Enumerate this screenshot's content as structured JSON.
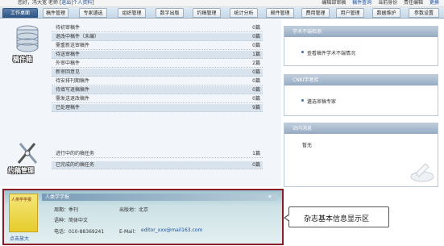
{
  "topbar": {
    "greeting": "您好，冯大宽 老师",
    "links": [
      "退出",
      "个人资料"
    ],
    "right": [
      "编辑部审稿",
      "稿件查询",
      "当前身份",
      "责任编辑",
      "更换"
    ]
  },
  "nav": {
    "tabs": [
      "工作桌面",
      "稿件管理",
      "专家遴选",
      "组织管理",
      "数字出版",
      "约稿管理",
      "统计分析",
      "邮件管理",
      "费用管理",
      "用户管理",
      "数据维护",
      "参数设置"
    ]
  },
  "manuscripts": {
    "title": "稿件箱",
    "rows": [
      {
        "label": "待初审稿件",
        "count": "0篇"
      },
      {
        "label": "退改中稿件（未编）",
        "count": "0篇"
      },
      {
        "label": "需重新送审稿件",
        "count": "0篇"
      },
      {
        "label": "待送审稿件",
        "count": "1篇"
      },
      {
        "label": "外审中稿件",
        "count": "2篇"
      },
      {
        "label": "新审回意见",
        "count": "0篇"
      },
      {
        "label": "待安排刊期稿件",
        "count": "0篇"
      },
      {
        "label": "待填写退稿稿件",
        "count": "0篇"
      },
      {
        "label": "需发送退改稿件",
        "count": "0篇"
      },
      {
        "label": "已处理稿件",
        "count": "9篇"
      }
    ]
  },
  "solicit": {
    "title": "约稿管理",
    "rows": [
      {
        "label": "进行中的约稿任务",
        "count": "1篇"
      },
      {
        "label": "已完成的约稿任务",
        "count": "0篇"
      }
    ]
  },
  "side": {
    "misconduct": {
      "title": "学术不端检测",
      "item": "查看稿件学术不端情况"
    },
    "cnki": {
      "title": "CNKI学者库",
      "item": "遴选审稿专家"
    },
    "notice": {
      "title": "站内消息",
      "item": "暂无"
    }
  },
  "magazine": {
    "cover_title": "人类学学报",
    "cover_link": "点击放大",
    "name_bar": "人类学学报",
    "period_label": "周期：季刊",
    "place_label": "出版地：北京",
    "lang_label": "语种：简体中文",
    "phone_label": "电话：010-88369241",
    "email_label": "E-Mail：",
    "email": "editor_xxx@mail163.com"
  },
  "callout": {
    "text": "杂志基本信息显示区"
  }
}
